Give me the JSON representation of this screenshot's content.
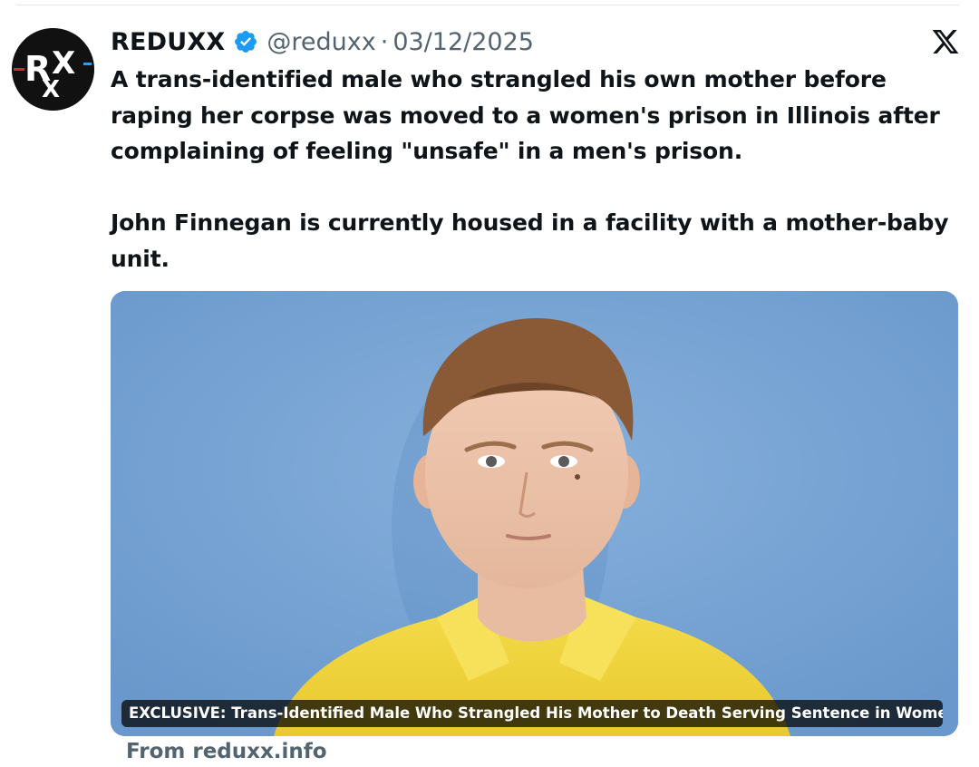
{
  "author": {
    "avatar_text": "RXX",
    "name": "REDUXX",
    "handle": "@reduxx",
    "separator": "·",
    "date": "03/12/2025",
    "verified_color": "#1d9bf0"
  },
  "platform_icon": "x-logo-icon",
  "tweet": {
    "paragraphs": [
      "A trans-identified male who strangled his own mother before raping her corpse was moved to a women's prison in Illinois after complaining of feeling \"unsafe\" in a men's prison.",
      "John Finnegan is currently housed in a facility with a mother-baby unit."
    ]
  },
  "media": {
    "caption": "EXCLUSIVE: Trans-Identified Male Who Strangled His Mother to Death Serving Sentence in Women's..."
  },
  "source": {
    "text": "From reduxx.info"
  },
  "colors": {
    "text": "#0f1419",
    "secondary": "#536471",
    "photo_background": "#79a5d6",
    "shirt": "#f2d63a"
  }
}
